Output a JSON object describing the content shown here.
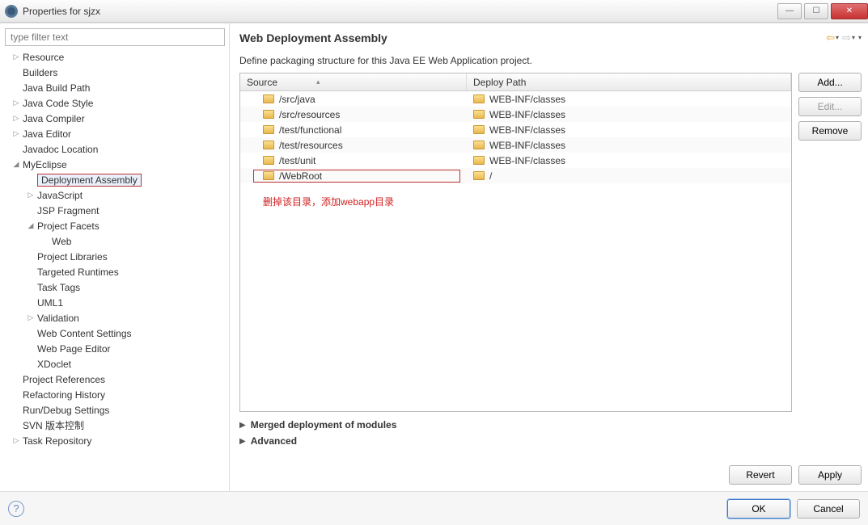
{
  "window": {
    "title": "Properties for sjzx",
    "controls": {
      "min": "—",
      "max": "☐",
      "close": "✕"
    }
  },
  "sidebar": {
    "filter_placeholder": "type filter text",
    "items": [
      {
        "label": "Resource",
        "indent": 0,
        "tw": "▷"
      },
      {
        "label": "Builders",
        "indent": 0,
        "tw": ""
      },
      {
        "label": "Java Build Path",
        "indent": 0,
        "tw": ""
      },
      {
        "label": "Java Code Style",
        "indent": 0,
        "tw": "▷"
      },
      {
        "label": "Java Compiler",
        "indent": 0,
        "tw": "▷"
      },
      {
        "label": "Java Editor",
        "indent": 0,
        "tw": "▷"
      },
      {
        "label": "Javadoc Location",
        "indent": 0,
        "tw": ""
      },
      {
        "label": "MyEclipse",
        "indent": 0,
        "tw": "◢"
      },
      {
        "label": "Deployment Assembly",
        "indent": 1,
        "tw": "",
        "selected": true
      },
      {
        "label": "JavaScript",
        "indent": 1,
        "tw": "▷"
      },
      {
        "label": "JSP Fragment",
        "indent": 1,
        "tw": ""
      },
      {
        "label": "Project Facets",
        "indent": 1,
        "tw": "◢"
      },
      {
        "label": "Web",
        "indent": 2,
        "tw": ""
      },
      {
        "label": "Project Libraries",
        "indent": 1,
        "tw": ""
      },
      {
        "label": "Targeted Runtimes",
        "indent": 1,
        "tw": ""
      },
      {
        "label": "Task Tags",
        "indent": 1,
        "tw": ""
      },
      {
        "label": "UML1",
        "indent": 1,
        "tw": ""
      },
      {
        "label": "Validation",
        "indent": 1,
        "tw": "▷"
      },
      {
        "label": "Web Content Settings",
        "indent": 1,
        "tw": ""
      },
      {
        "label": "Web Page Editor",
        "indent": 1,
        "tw": ""
      },
      {
        "label": "XDoclet",
        "indent": 1,
        "tw": ""
      },
      {
        "label": "Project References",
        "indent": 0,
        "tw": ""
      },
      {
        "label": "Refactoring History",
        "indent": 0,
        "tw": ""
      },
      {
        "label": "Run/Debug Settings",
        "indent": 0,
        "tw": ""
      },
      {
        "label": "SVN 版本控制",
        "indent": 0,
        "tw": ""
      },
      {
        "label": "Task Repository",
        "indent": 0,
        "tw": "▷"
      }
    ]
  },
  "panel": {
    "title": "Web Deployment Assembly",
    "description": "Define packaging structure for this Java EE Web Application project.",
    "columns": {
      "source": "Source",
      "deploy": "Deploy Path"
    },
    "rows": [
      {
        "source": "/src/java",
        "deploy": "WEB-INF/classes"
      },
      {
        "source": "/src/resources",
        "deploy": "WEB-INF/classes"
      },
      {
        "source": "/test/functional",
        "deploy": "WEB-INF/classes"
      },
      {
        "source": "/test/resources",
        "deploy": "WEB-INF/classes"
      },
      {
        "source": "/test/unit",
        "deploy": "WEB-INF/classes"
      },
      {
        "source": "/WebRoot",
        "deploy": "/",
        "highlight": true
      }
    ],
    "annotation": "删掉该目录，添加webapp目录",
    "buttons": {
      "add": "Add...",
      "edit": "Edit...",
      "remove": "Remove"
    },
    "collapsers": {
      "merged": "Merged deployment of modules",
      "advanced": "Advanced"
    },
    "lower": {
      "revert": "Revert",
      "apply": "Apply"
    }
  },
  "footer": {
    "ok": "OK",
    "cancel": "Cancel",
    "help": "?"
  }
}
